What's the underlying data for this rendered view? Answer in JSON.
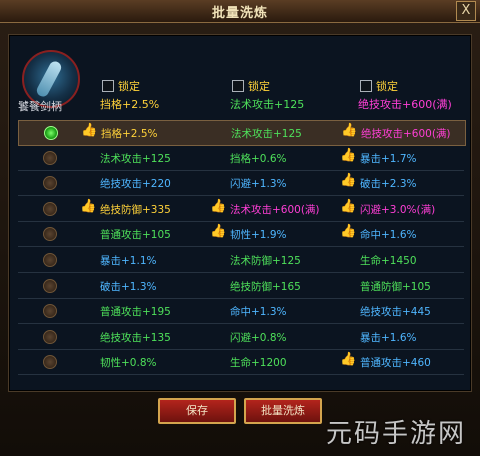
{
  "window": {
    "title": "批量洗炼",
    "close_label": "X"
  },
  "item": {
    "name": "饕餮剑柄"
  },
  "locks": [
    {
      "label": "锁定",
      "current": "挡格+2.5%",
      "color": "#ffd23a"
    },
    {
      "label": "锁定",
      "current": "法术攻击+125",
      "color": "#4ee05a"
    },
    {
      "label": "锁定",
      "current": "绝技攻击+600(满)",
      "color": "#ff3fd6"
    }
  ],
  "rows": [
    {
      "selected": true,
      "c1": {
        "text": "挡格+2.5%",
        "color": "#ffd23a",
        "thumb": true
      },
      "c2": {
        "text": "法术攻击+125",
        "color": "#4ee05a",
        "thumb": false
      },
      "c3": {
        "text": "绝技攻击+600(满)",
        "color": "#ff3fd6",
        "thumb": true
      }
    },
    {
      "selected": false,
      "c1": {
        "text": "法术攻击+125",
        "color": "#4ee05a",
        "thumb": false
      },
      "c2": {
        "text": "挡格+0.6%",
        "color": "#4ee05a",
        "thumb": false
      },
      "c3": {
        "text": "暴击+1.7%",
        "color": "#4fb6ff",
        "thumb": true
      }
    },
    {
      "selected": false,
      "c1": {
        "text": "绝技攻击+220",
        "color": "#4fb6ff",
        "thumb": false
      },
      "c2": {
        "text": "闪避+1.3%",
        "color": "#4fb6ff",
        "thumb": false
      },
      "c3": {
        "text": "破击+2.3%",
        "color": "#4fb6ff",
        "thumb": true
      }
    },
    {
      "selected": false,
      "c1": {
        "text": "绝技防御+335",
        "color": "#ffd23a",
        "thumb": true
      },
      "c2": {
        "text": "法术攻击+600(满)",
        "color": "#ff3fd6",
        "thumb": true
      },
      "c3": {
        "text": "闪避+3.0%(满)",
        "color": "#ff3fd6",
        "thumb": true
      }
    },
    {
      "selected": false,
      "c1": {
        "text": "普通攻击+105",
        "color": "#4ee05a",
        "thumb": false
      },
      "c2": {
        "text": "韧性+1.9%",
        "color": "#4fb6ff",
        "thumb": true
      },
      "c3": {
        "text": "命中+1.6%",
        "color": "#4fb6ff",
        "thumb": true
      }
    },
    {
      "selected": false,
      "c1": {
        "text": "暴击+1.1%",
        "color": "#4fb6ff",
        "thumb": false
      },
      "c2": {
        "text": "法术防御+125",
        "color": "#4ee05a",
        "thumb": false
      },
      "c3": {
        "text": "生命+1450",
        "color": "#4ee05a",
        "thumb": false
      }
    },
    {
      "selected": false,
      "c1": {
        "text": "破击+1.3%",
        "color": "#4fb6ff",
        "thumb": false
      },
      "c2": {
        "text": "绝技防御+165",
        "color": "#4ee05a",
        "thumb": false
      },
      "c3": {
        "text": "普通防御+105",
        "color": "#4ee05a",
        "thumb": false
      }
    },
    {
      "selected": false,
      "c1": {
        "text": "普通攻击+195",
        "color": "#4ee05a",
        "thumb": false
      },
      "c2": {
        "text": "命中+1.3%",
        "color": "#4fb6ff",
        "thumb": false
      },
      "c3": {
        "text": "绝技攻击+445",
        "color": "#4fb6ff",
        "thumb": false
      }
    },
    {
      "selected": false,
      "c1": {
        "text": "绝技攻击+135",
        "color": "#4ee05a",
        "thumb": false
      },
      "c2": {
        "text": "闪避+0.8%",
        "color": "#4ee05a",
        "thumb": false
      },
      "c3": {
        "text": "暴击+1.6%",
        "color": "#4fb6ff",
        "thumb": false
      }
    },
    {
      "selected": false,
      "c1": {
        "text": "韧性+0.8%",
        "color": "#4ee05a",
        "thumb": false
      },
      "c2": {
        "text": "生命+1200",
        "color": "#4ee05a",
        "thumb": false
      },
      "c3": {
        "text": "普通攻击+460",
        "color": "#4fb6ff",
        "thumb": true
      }
    }
  ],
  "buttons": {
    "save": "保存",
    "batch": "批量洗炼"
  },
  "watermark": "元码手游网"
}
